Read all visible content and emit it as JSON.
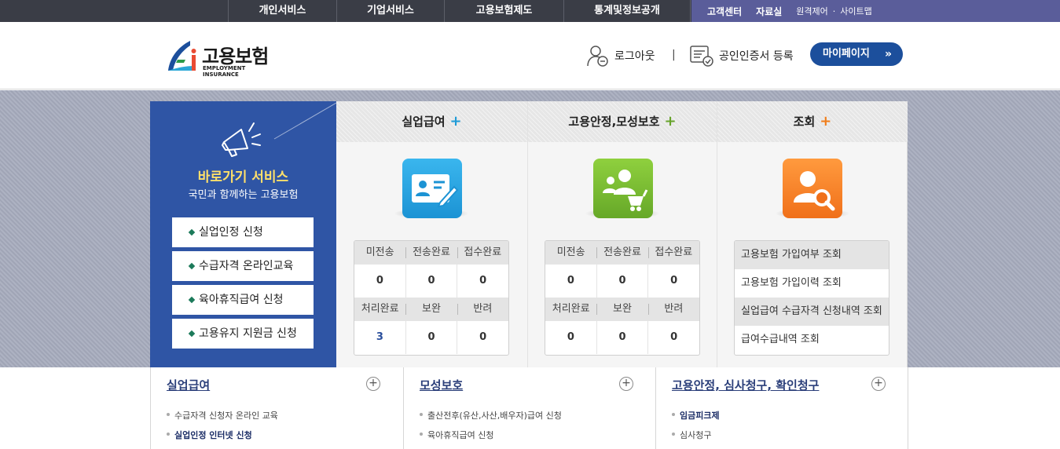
{
  "topnav": {
    "menu": [
      "개인서비스",
      "기업서비스",
      "고용보험제도",
      "통계및정보공개"
    ],
    "util": {
      "customer_center": "고객센터",
      "archive": "자료실",
      "remote": "원격제어",
      "dot": "·",
      "sitemap": "사이트맵"
    }
  },
  "header": {
    "logo_ko": "고용보험",
    "logo_en": "EMPLOYMENT INSURANCE",
    "logout": "로그아웃",
    "separator": "|",
    "cert_register": "공인인증서 등록",
    "mypage": "마이페이지",
    "mypage_chevron": "»"
  },
  "shortcut": {
    "title": "바로가기 서비스",
    "subtitle": "국민과 함께하는 고용보험",
    "buttons": [
      "실업인정 신청",
      "수급자격 온라인교육",
      "육아휴직급여 신청",
      "고용유지 지원금 신청"
    ]
  },
  "panels": [
    {
      "title": "실업급여",
      "plus": "+",
      "plus_color": "#1e9bd7",
      "icon": "id-card-edit-icon",
      "icon_color": "#26a3df",
      "status": {
        "headers1": [
          "미전송",
          "전송완료",
          "접수완료"
        ],
        "values1": [
          "0",
          "0",
          "0"
        ],
        "headers2": [
          "처리완료",
          "보완",
          "반려"
        ],
        "values2": [
          "3",
          "0",
          "0"
        ]
      }
    },
    {
      "title": "고용안정,모성보호",
      "plus": "+",
      "plus_color": "#66a32a",
      "icon": "family-stroller-icon",
      "icon_color": "#7cbc32",
      "status": {
        "headers1": [
          "미전송",
          "전송완료",
          "접수완료"
        ],
        "values1": [
          "0",
          "0",
          "0"
        ],
        "headers2": [
          "처리완료",
          "보완",
          "반려"
        ],
        "values2": [
          "0",
          "0",
          "0"
        ]
      }
    },
    {
      "title": "조회",
      "plus": "+",
      "plus_color": "#f07d1a",
      "icon": "user-search-icon",
      "icon_color": "#f6832a",
      "lookups": [
        "고용보험 가입여부 조회",
        "고용보험 가입이력 조회",
        "실업급여 수급자격 신청내역 조회",
        "급여수급내역 조회"
      ]
    }
  ],
  "bottom": [
    {
      "title": "실업급여",
      "plus": "+",
      "items": [
        {
          "label": "수급자격 신청자 온라인 교육",
          "strong": false
        },
        {
          "label": "실업인정 인터넷 신청",
          "strong": true
        }
      ]
    },
    {
      "title": "모성보호",
      "plus": "+",
      "items": [
        {
          "label": "출산전후(유산,사산,배우자)급여 신청",
          "strong": false
        },
        {
          "label": "육아휴직급여 신청",
          "strong": false
        }
      ]
    },
    {
      "title": "고용안정, 심사청구, 확인청구",
      "plus": "+",
      "items": [
        {
          "label": "임금피크제",
          "strong": true
        },
        {
          "label": "심사청구",
          "strong": false
        }
      ]
    }
  ]
}
